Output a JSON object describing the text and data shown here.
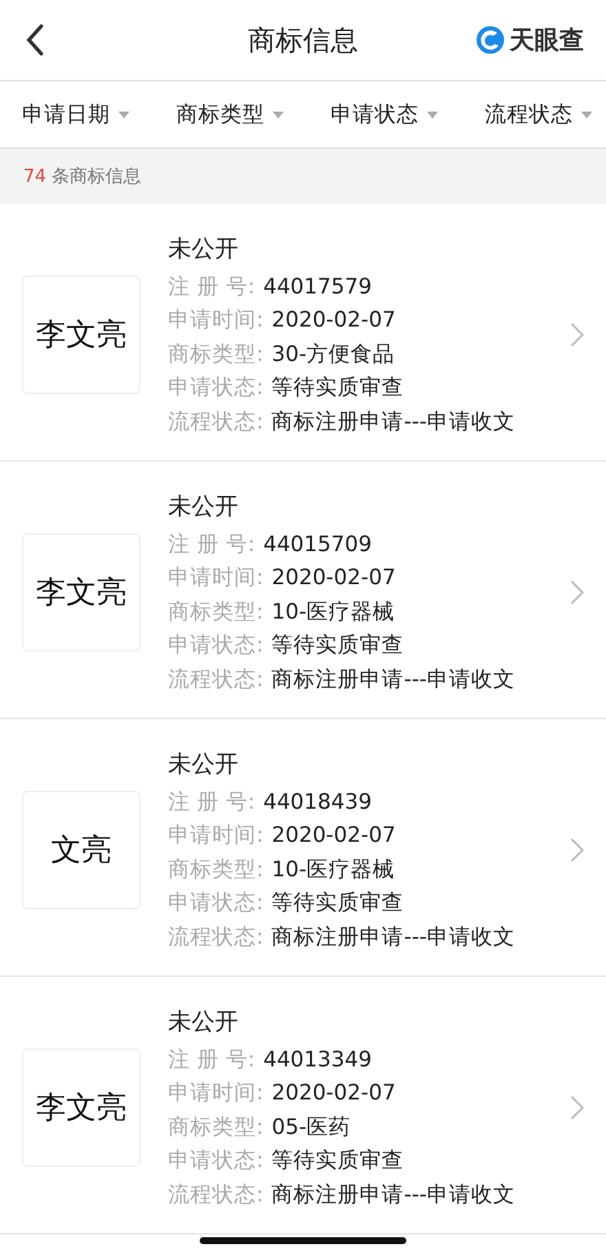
{
  "header": {
    "title": "商标信息",
    "brand": "天眼查"
  },
  "filters": [
    {
      "label": "申请日期"
    },
    {
      "label": "商标类型"
    },
    {
      "label": "申请状态"
    },
    {
      "label": "流程状态"
    }
  ],
  "summary": {
    "count": "74",
    "text": "条商标信息"
  },
  "trademarks": [
    {
      "logo_text": "李文亮",
      "name": "未公开",
      "fields": [
        {
          "label": "注 册 号:",
          "value": "44017579"
        },
        {
          "label": "申请时间:",
          "value": "2020-02-07"
        },
        {
          "label": "商标类型:",
          "value": "30-方便食品"
        },
        {
          "label": "申请状态:",
          "value": "等待实质审查"
        },
        {
          "label": "流程状态:",
          "value": "商标注册申请---申请收文"
        }
      ]
    },
    {
      "logo_text": "李文亮",
      "name": "未公开",
      "fields": [
        {
          "label": "注 册 号:",
          "value": "44015709"
        },
        {
          "label": "申请时间:",
          "value": "2020-02-07"
        },
        {
          "label": "商标类型:",
          "value": "10-医疗器械"
        },
        {
          "label": "申请状态:",
          "value": "等待实质审查"
        },
        {
          "label": "流程状态:",
          "value": "商标注册申请---申请收文"
        }
      ]
    },
    {
      "logo_text": "文亮",
      "name": "未公开",
      "fields": [
        {
          "label": "注 册 号:",
          "value": "44018439"
        },
        {
          "label": "申请时间:",
          "value": "2020-02-07"
        },
        {
          "label": "商标类型:",
          "value": "10-医疗器械"
        },
        {
          "label": "申请状态:",
          "value": "等待实质审查"
        },
        {
          "label": "流程状态:",
          "value": "商标注册申请---申请收文"
        }
      ]
    },
    {
      "logo_text": "李文亮",
      "name": "未公开",
      "fields": [
        {
          "label": "注 册 号:",
          "value": "44013349"
        },
        {
          "label": "申请时间:",
          "value": "2020-02-07"
        },
        {
          "label": "商标类型:",
          "value": "05-医药"
        },
        {
          "label": "申请状态:",
          "value": "等待实质审查"
        },
        {
          "label": "流程状态:",
          "value": "商标注册申请---申请收文"
        }
      ]
    }
  ]
}
